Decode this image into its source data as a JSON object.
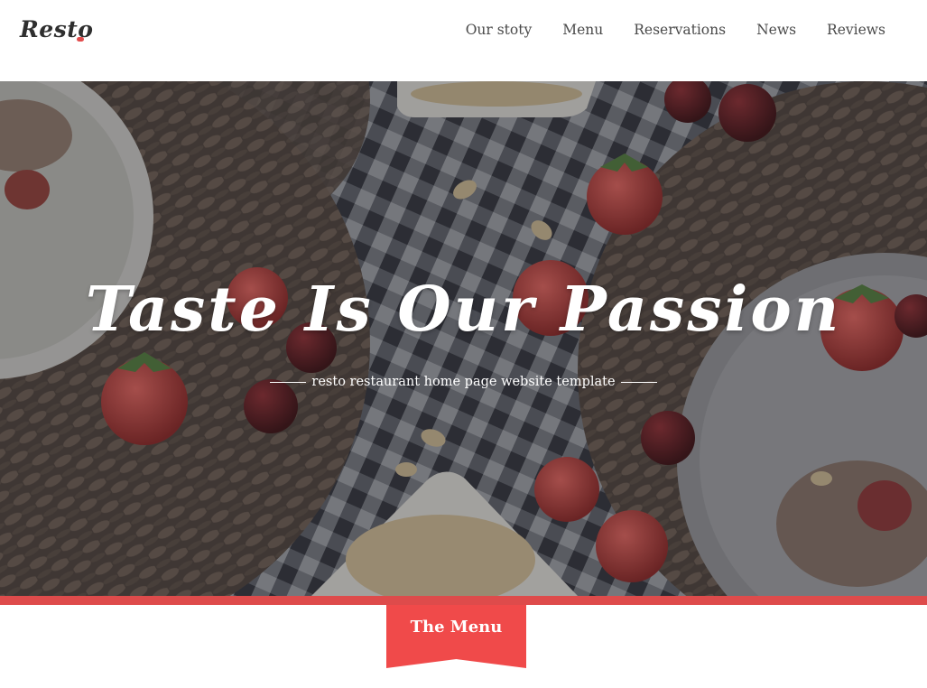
{
  "header": {
    "logo_text": "Resto",
    "nav": [
      {
        "label": "Our stoty"
      },
      {
        "label": "Menu"
      },
      {
        "label": "Reservations"
      },
      {
        "label": "News"
      },
      {
        "label": "Reviews"
      }
    ]
  },
  "hero": {
    "title": "Taste Is Our Passion",
    "subtitle": "resto restaurant home page website template"
  },
  "section": {
    "ribbon_label": "The Menu"
  },
  "colors": {
    "accent": "#de4b4b",
    "ribbon": "#f04a4a",
    "nav_text": "#4a4a4a",
    "hero_text": "#ffffff"
  }
}
